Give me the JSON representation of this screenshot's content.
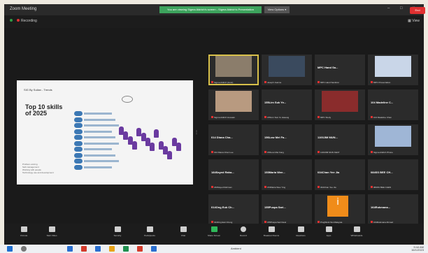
{
  "window": {
    "title": "Zoom Meeting",
    "share_banner": "You are viewing Sigma Aldrich's screen - Sigma Aldrich's Presentation",
    "view_options_label": "View Options ▾",
    "controls": {
      "minimize": "–",
      "maximize": "□",
      "close": "×"
    }
  },
  "subbar": {
    "recording_label": "Recording",
    "view_label": "View"
  },
  "slide": {
    "header": "SIG By Sullan - Trends",
    "title_lines": [
      "Top 10 skills",
      "of 2025"
    ],
    "list_items": [
      "Analytical thinking and innovation",
      "Active learning and learning strategies",
      "Complex problem-solving",
      "Critical thinking and analysis",
      "Creativity, originality and initiative",
      "Leadership and social influence",
      "Technology use, monitoring and control",
      "Technology design and programming",
      "Resilience, stress tolerance and flexibility",
      "Reasoning, problem-solving and ideation"
    ],
    "legend": [
      "Problem-solving",
      "Self-management",
      "Working with people",
      "Technology use and development"
    ],
    "accent": "#3c78b4",
    "illustration_color": "#6a3aa0"
  },
  "tiles": [
    {
      "name": "",
      "caption": "Sigma Aldrich (Host)",
      "photo": "logo-board"
    },
    {
      "name": "",
      "caption": "Joseph Joanne",
      "photo": "dark-scene"
    },
    {
      "name": "MPC Hand Sa...",
      "caption": "MPC Hand Sanitizer",
      "photo": ""
    },
    {
      "name": "",
      "caption": "MPC Presentation",
      "photo": "flag"
    },
    {
      "name": "",
      "caption": "Sigma Aldrich Hussain",
      "photo": "person"
    },
    {
      "name": "155Lim Suk Ye...",
      "caption": "155Lim Suk Ye Hasang",
      "photo": ""
    },
    {
      "name": "",
      "caption": "MPC Study",
      "photo": "person-red"
    },
    {
      "name": "104 Madeline C...",
      "caption": "104 Madeline Chan",
      "photo": ""
    },
    {
      "name": "014 Diana Cha...",
      "caption": "014 Diana Chan Lee",
      "photo": ""
    },
    {
      "name": "156Low Mei Fa...",
      "caption": "156Low Mei Fang",
      "photo": ""
    },
    {
      "name": "1100JIM MUN...",
      "caption": "1100JIM MUN KEAT",
      "photo": ""
    },
    {
      "name": "",
      "caption": "Sigma Aldrich Phone",
      "photo": "avatar"
    },
    {
      "name": "184Sayed Raha...",
      "caption": "184Sayed Rahman",
      "photo": ""
    },
    {
      "name": "153Maria Wee...",
      "caption": "153Maria Wee Ying",
      "photo": ""
    },
    {
      "name": "034Chan Yee Jia",
      "caption": "034Chan Yee Jia",
      "photo": ""
    },
    {
      "name": "084SS BEE CH...",
      "caption": "084SS BEE CHEN",
      "photo": ""
    },
    {
      "name": "014Ong Euk Ch...",
      "caption": "014Ong Euk Chong",
      "photo": ""
    },
    {
      "name": "155Puspa Sari...",
      "caption": "155Puspa Sari Dewi",
      "photo": ""
    },
    {
      "name": "",
      "caption": "ProgWork Stu Malaysia",
      "photo": "orange-i"
    },
    {
      "name": "164Rukmana...",
      "caption": "164Rukmana Ahmad",
      "photo": ""
    }
  ],
  "toolbar": [
    {
      "label": "Unmute",
      "icon": "mic-icon"
    },
    {
      "label": "Start Video",
      "icon": "video-icon"
    },
    {
      "label": "Security",
      "icon": "shield-icon"
    },
    {
      "label": "Participants",
      "icon": "participants-icon"
    },
    {
      "label": "Chat",
      "icon": "chat-icon"
    },
    {
      "label": "Share Screen",
      "icon": "share-screen-icon"
    },
    {
      "label": "Record",
      "icon": "record-icon"
    },
    {
      "label": "Breakout Rooms",
      "icon": "breakout-icon"
    },
    {
      "label": "Reactions",
      "icon": "reactions-icon"
    },
    {
      "label": "Apps",
      "icon": "apps-icon"
    },
    {
      "label": "Whiteboards",
      "icon": "whiteboard-icon"
    }
  ],
  "end_label": "End",
  "taskbar": {
    "search_placeholder": "Type here to search",
    "weather": "Ambient",
    "time": "9:44 AM",
    "date": "16/1/2023",
    "app_colors": [
      "#2a6fd0",
      "#d33b2c",
      "#2a6fd0",
      "#e8a317",
      "#1f8f4e",
      "#d33b2c",
      "#2a6fd0"
    ]
  }
}
